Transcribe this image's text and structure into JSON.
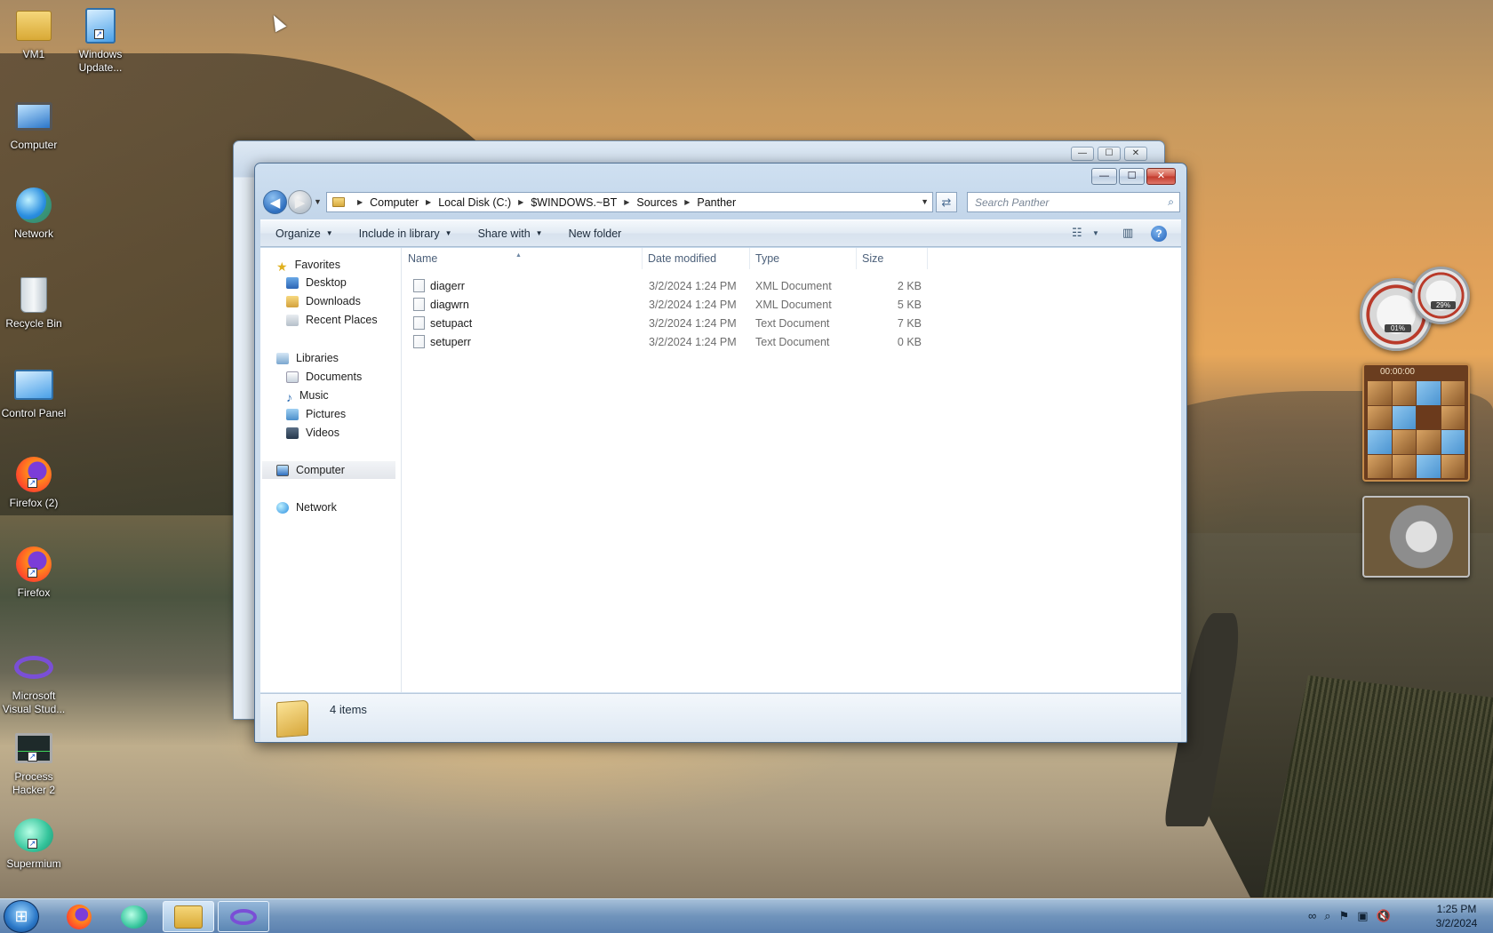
{
  "desktop": {
    "icons": [
      {
        "label": "VM1",
        "icon": "user-folder-icon"
      },
      {
        "label": "Windows Update...",
        "icon": "windows-update-icon"
      },
      {
        "label": "Computer",
        "icon": "computer-icon"
      },
      {
        "label": "Network",
        "icon": "network-icon"
      },
      {
        "label": "Recycle Bin",
        "icon": "recycle-bin-icon"
      },
      {
        "label": "Control Panel",
        "icon": "control-panel-icon"
      },
      {
        "label": "Firefox (2)",
        "icon": "firefox-icon"
      },
      {
        "label": "Firefox",
        "icon": "firefox-icon"
      },
      {
        "label": "Microsoft Visual Stud...",
        "icon": "visual-studio-icon"
      },
      {
        "label": "Process Hacker 2",
        "icon": "process-hacker-icon"
      },
      {
        "label": "Supermium",
        "icon": "supermium-icon"
      }
    ]
  },
  "explorer": {
    "back_icon": "◀",
    "forward_icon": "▶",
    "close_glyph": "✕",
    "minimize_glyph": "—",
    "maximize_glyph": "☐",
    "breadcrumb": [
      "Computer",
      "Local Disk (C:)",
      "$WINDOWS.~BT",
      "Sources",
      "Panther"
    ],
    "search_placeholder": "Search Panther",
    "toolbar": {
      "organize": "Organize",
      "include_in_library": "Include in library",
      "share_with": "Share with",
      "new_folder": "New folder"
    },
    "nav": {
      "favorites": "Favorites",
      "desktop": "Desktop",
      "downloads": "Downloads",
      "recent_places": "Recent Places",
      "libraries": "Libraries",
      "documents": "Documents",
      "music": "Music",
      "pictures": "Pictures",
      "videos": "Videos",
      "computer": "Computer",
      "network": "Network"
    },
    "columns": {
      "name": "Name",
      "date_modified": "Date modified",
      "type": "Type",
      "size": "Size"
    },
    "files": [
      {
        "name": "diagerr",
        "date": "3/2/2024 1:24 PM",
        "type": "XML Document",
        "size": "2 KB"
      },
      {
        "name": "diagwrn",
        "date": "3/2/2024 1:24 PM",
        "type": "XML Document",
        "size": "5 KB"
      },
      {
        "name": "setupact",
        "date": "3/2/2024 1:24 PM",
        "type": "Text Document",
        "size": "7 KB"
      },
      {
        "name": "setuperr",
        "date": "3/2/2024 1:24 PM",
        "type": "Text Document",
        "size": "0 KB"
      }
    ],
    "status_count": "4 items"
  },
  "gadgets": {
    "cpu_percent": "01%",
    "mem_percent": "29%",
    "timer": "00:00:00"
  },
  "taskbar": {
    "time": "1:25 PM",
    "date": "3/2/2024"
  },
  "colors": {
    "accent": "#2f6fbf",
    "close": "#c0392b"
  }
}
